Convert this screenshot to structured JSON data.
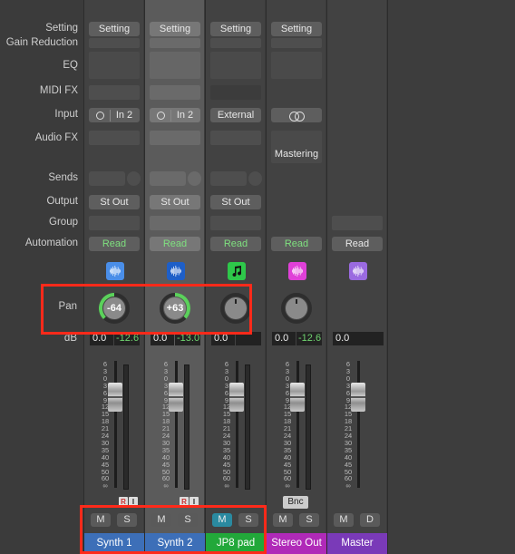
{
  "row_labels": {
    "setting": "Setting",
    "gain_reduction": "Gain Reduction",
    "eq": "EQ",
    "midi_fx": "MIDI FX",
    "input": "Input",
    "audio_fx": "Audio FX",
    "sends": "Sends",
    "output": "Output",
    "group": "Group",
    "automation": "Automation",
    "pan": "Pan",
    "db": "dB"
  },
  "fader_scale": [
    "6",
    "3",
    "0",
    "3",
    "6",
    "9",
    "12",
    "15",
    "18",
    "21",
    "24",
    "30",
    "35",
    "40",
    "45",
    "50",
    "60",
    "∞"
  ],
  "channels": [
    {
      "name": "Synth 1",
      "name_color": "#3d6fb8",
      "setting": "Setting",
      "input": "In 2",
      "output": "St Out",
      "automation": "Read",
      "icon": "waveform-icon",
      "icon_color": "#4a8ee8",
      "pan": "-64",
      "pan_value": -64,
      "db_volume": "0.0",
      "db_peak": "-12.6",
      "mute": "M",
      "solo": "S",
      "record": "R",
      "input_monitor": "I"
    },
    {
      "name": "Synth 2",
      "name_color": "#3d6fb8",
      "setting": "Setting",
      "input": "In 2",
      "output": "St Out",
      "automation": "Read",
      "icon": "waveform-icon",
      "icon_color": "#1e5fc8",
      "pan": "+63",
      "pan_value": 63,
      "db_volume": "0.0",
      "db_peak": "-13.0",
      "mute": "M",
      "solo": "S",
      "record": "R",
      "input_monitor": "I"
    },
    {
      "name": "JP8 pad",
      "name_color": "#22a83a",
      "setting": "Setting",
      "input": "External",
      "output": "St Out",
      "automation": "Read",
      "icon": "music-note-icon",
      "icon_color": "#2ec84a",
      "pan_value": 0,
      "db_volume": "0.0",
      "mute": "M",
      "solo": "S"
    },
    {
      "name": "Stereo Out",
      "name_color": "#b02ab8",
      "setting": "Setting",
      "audio_fx": "Mastering",
      "automation": "Read",
      "icon": "waveform-icon",
      "icon_color": "#e040d8",
      "pan_value": 0,
      "db_volume": "0.0",
      "db_peak": "-12.6",
      "bnc": "Bnc",
      "mute": "M",
      "solo": "S"
    },
    {
      "name": "Master",
      "name_color": "#7a3ab8",
      "automation": "Read",
      "icon": "waveform-icon",
      "icon_color": "#9a6ae0",
      "db_volume": "0.0",
      "mute": "M",
      "dim": "D"
    }
  ]
}
